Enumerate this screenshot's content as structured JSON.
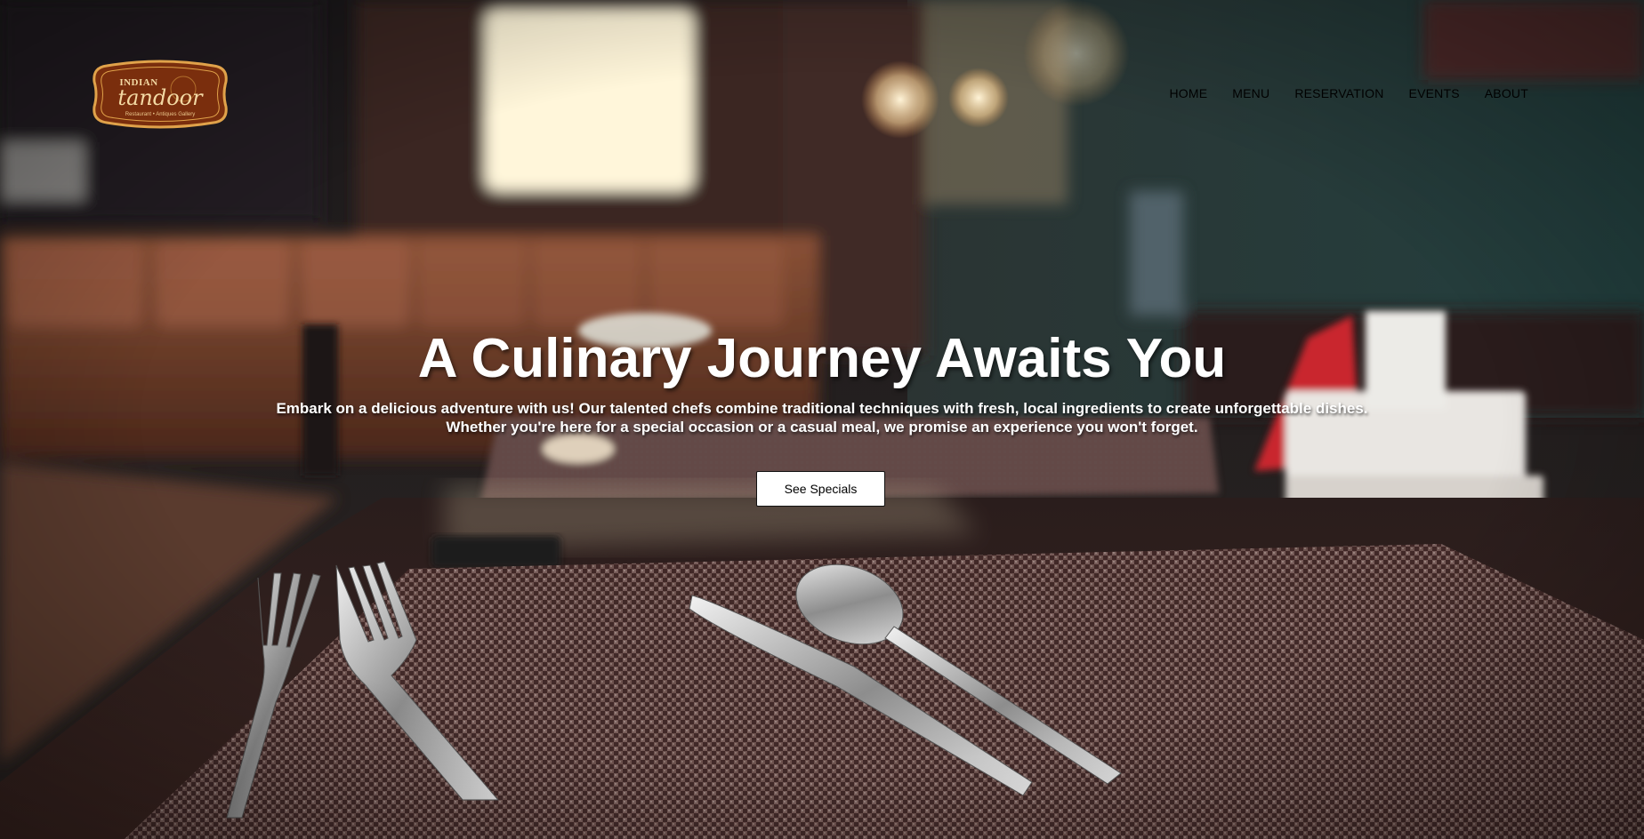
{
  "brand": {
    "top_word": "INDIAN",
    "name": "tandoor",
    "tagline": "Restaurant • Antiques Gallery"
  },
  "nav": {
    "items": [
      "HOME",
      "MENU",
      "RESERVATION",
      "EVENTS",
      "ABOUT"
    ]
  },
  "hero": {
    "headline": "A Culinary Journey Awaits You",
    "subtext_line1": "Embark on a delicious adventure with us! Our talented chefs combine traditional techniques with fresh, local ingredients to create unforgettable dishes.",
    "subtext_line2": "Whether you're here for a special occasion or a casual meal, we promise an experience you won't forget.",
    "cta_label": "See Specials"
  },
  "colors": {
    "logo_fill": "#7a2e0d",
    "logo_border": "#e0a24a",
    "logo_text": "#f3d9a4",
    "headline": "#ffffff",
    "button_bg": "#ffffff"
  }
}
